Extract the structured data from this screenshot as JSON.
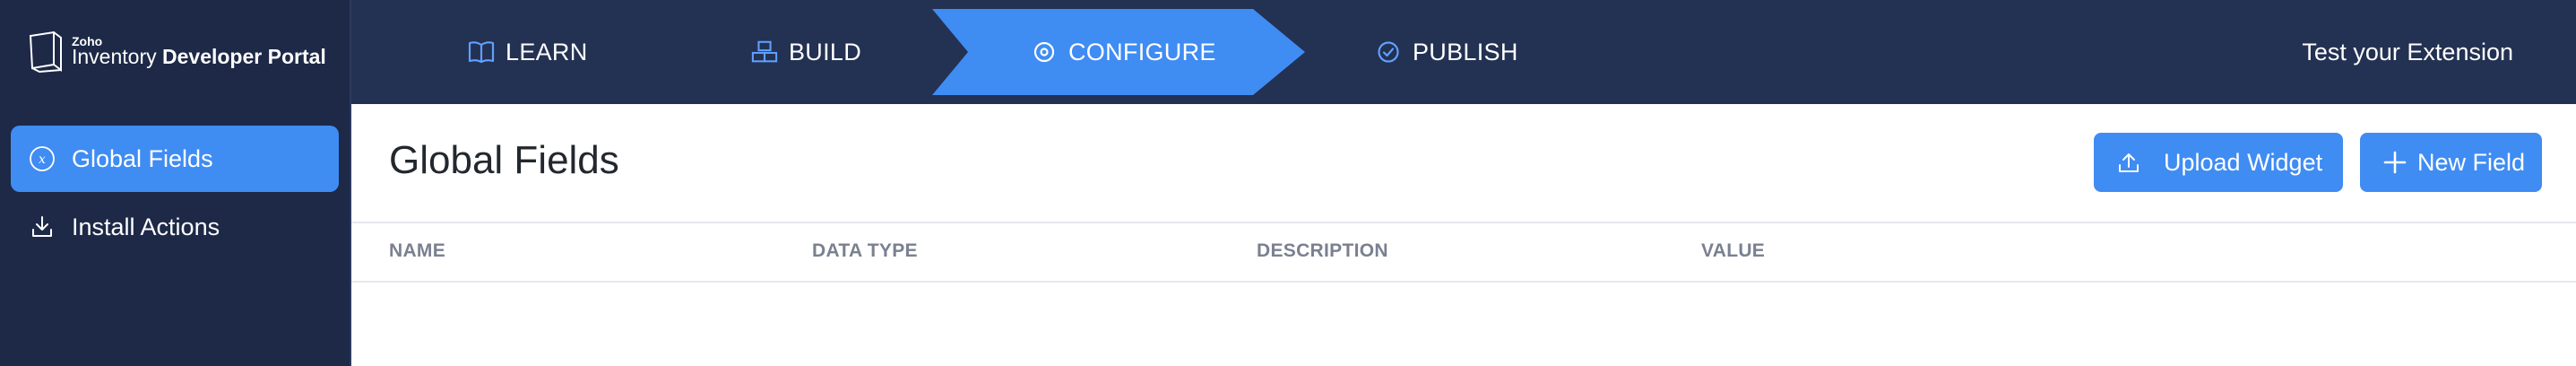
{
  "brand": {
    "zoho": "Zoho",
    "product": "Inventory",
    "portal": "Developer Portal"
  },
  "steps": [
    {
      "label": "LEARN",
      "icon": "book-icon",
      "active": false
    },
    {
      "label": "BUILD",
      "icon": "blocks-icon",
      "active": false
    },
    {
      "label": "CONFIGURE",
      "icon": "gear-icon",
      "active": true
    },
    {
      "label": "PUBLISH",
      "icon": "check-circle-icon",
      "active": false
    }
  ],
  "header": {
    "test_extension": "Test your Extension"
  },
  "sidebar": {
    "items": [
      {
        "label": "Global Fields",
        "icon": "variable-icon",
        "active": true
      },
      {
        "label": "Install Actions",
        "icon": "download-icon",
        "active": false
      }
    ]
  },
  "main": {
    "title": "Global Fields",
    "upload_button": "Upload Widget",
    "new_button": "New Field",
    "columns": [
      "NAME",
      "DATA TYPE",
      "DESCRIPTION",
      "VALUE"
    ]
  },
  "colors": {
    "topbar": "#233152",
    "sidebar": "#1d2947",
    "accent": "#3f8cf3",
    "header_text": "#7a8090"
  }
}
